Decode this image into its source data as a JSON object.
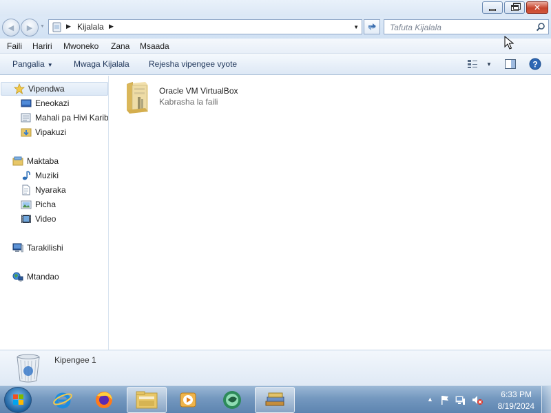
{
  "window": {
    "controls": [
      "minimize",
      "maximize",
      "close"
    ]
  },
  "address": {
    "path": "Kijalala",
    "search_placeholder": "Tafuta Kijalala"
  },
  "menu": [
    "Faili",
    "Hariri",
    "Mwoneko",
    "Zana",
    "Msaada"
  ],
  "commandbar": {
    "organize": "Pangalia",
    "empty": "Mwaga Kijalala",
    "restore_all": "Rejesha vipengee vyote"
  },
  "navigation": {
    "favorites": "Vipendwa",
    "desktop": "Eneokazi",
    "recent": "Mahali pa Hivi Karibuni",
    "downloads": "Vipakuzi",
    "libraries": "Maktaba",
    "music": "Muziki",
    "documents": "Nyaraka",
    "pictures": "Picha",
    "videos": "Video",
    "computer": "Tarakilishi",
    "network": "Mtandao"
  },
  "content": {
    "items": [
      {
        "name": "Oracle VM VirtualBox",
        "type": "Kabrasha la faili"
      }
    ]
  },
  "details": {
    "count": "Kipengee 1"
  },
  "taskbar": {
    "apps": [
      "internet-explorer",
      "firefox",
      "windows-explorer",
      "media-player",
      "virtualbox-guest",
      "books"
    ],
    "time": "6:33 PM",
    "date": "8/19/2024"
  },
  "colors": {
    "chrome_light": "#dde9f7",
    "taskbar": "#7498bf",
    "selection": "#dce8f6",
    "folder": "#e8c768"
  }
}
